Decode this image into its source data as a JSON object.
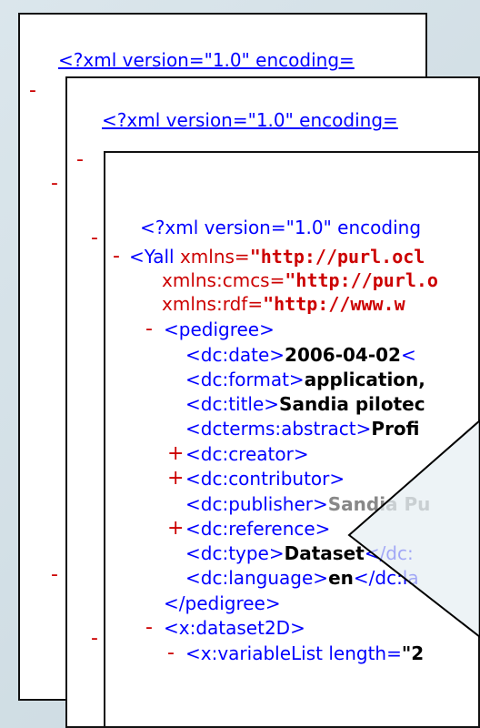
{
  "panel1": {
    "decl": "<?xml version=\"1.0\" encoding="
  },
  "panel2": {
    "decl": "<?xml version=\"1.0\" encoding="
  },
  "panel3": {
    "decl": "<?xml version=\"1.0\" encoding",
    "yall_open": "<Yall ",
    "yall_attr": "xmlns=",
    "yall_val": "\"http://purl.ocl",
    "cmcs_attr": "xmlns:cmcs=",
    "cmcs_val": "\"http://purl.o",
    "rdf_attr": "xmlns:rdf=",
    "rdf_val": "\"http://www.w",
    "pedigree_open": "<pedigree>",
    "date_open": "<dc:date>",
    "date_val": "2006-04-02",
    "date_close": "<",
    "format_open": "<dc:format>",
    "format_val": "application,",
    "title_open": "<dc:title>",
    "title_val": "Sandia pilotec",
    "abstract_open": "<dcterms:abstract>",
    "abstract_val": "Profi",
    "creator": "<dc:creator>",
    "contributor": "<dc:contributor>",
    "publisher_open": "<dc:publisher>",
    "publisher_val": "Sandia Pu",
    "reference": "<dc:reference>",
    "type_open": "<dc:type>",
    "type_val": "Dataset",
    "type_close": "</dc:",
    "lang_open": "<dc:language>",
    "lang_val": "en",
    "lang_close": "</dc:la",
    "pedigree_close": "</pedigree>",
    "dataset_open": "<x:dataset2D>",
    "varlist_open": "<x:variableList length=",
    "varlist_val": "\"2"
  },
  "toggles": {
    "minus": "-",
    "plus": "+"
  }
}
